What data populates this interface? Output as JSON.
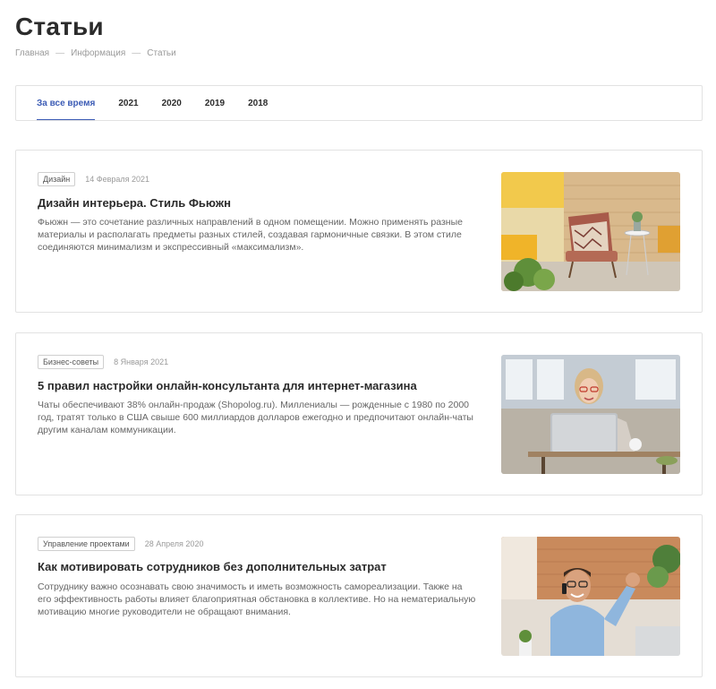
{
  "page": {
    "title": "Статьи",
    "breadcrumb": [
      "Главная",
      "Информация",
      "Статьи"
    ]
  },
  "tabs": [
    {
      "label": "За все время",
      "active": true
    },
    {
      "label": "2021",
      "active": false
    },
    {
      "label": "2020",
      "active": false
    },
    {
      "label": "2019",
      "active": false
    },
    {
      "label": "2018",
      "active": false
    }
  ],
  "articles": [
    {
      "tag": "Дизайн",
      "date": "14 Февраля 2021",
      "title": "Дизайн интерьера. Стиль Фьюжн",
      "text": "Фьюжн — это сочетание различных направлений в одном помещении. Можно применять разные материалы и располагать предметы разных стилей, создавая гармоничные связки. В этом стиле соединяются минимализм и экспрессивный «максимализм».",
      "image": "interior-armchair-photo"
    },
    {
      "tag": "Бизнес-советы",
      "date": "8 Января 2021",
      "title": "5 правил настройки онлайн-консультанта для интернет-магазина",
      "text": "Чаты обеспечивают 38% онлайн-продаж (Shopolog.ru). Миллениалы — рожденные с 1980 по 2000 год, тратят только в США свыше 600 миллиардов долларов ежегодно и предпочитают онлайн-чаты другим каналам коммуникации.",
      "image": "woman-laptop-photo"
    },
    {
      "tag": "Управление проектами",
      "date": "28 Апреля 2020",
      "title": "Как мотивировать сотрудников без дополнительных затрат",
      "text": "Сотруднику важно осознавать свою значимость и иметь возможность самореализации. Также на его эффективность работы влияет благоприятная обстановка в коллективе. Но на нематериальную мотивацию многие руководители не обращают внимания.",
      "image": "man-phone-photo"
    }
  ],
  "colors": {
    "accent": "#3b5bb5",
    "border": "#e2e2e2",
    "text": "#2b2b2b",
    "muted": "#9a9a9a"
  }
}
